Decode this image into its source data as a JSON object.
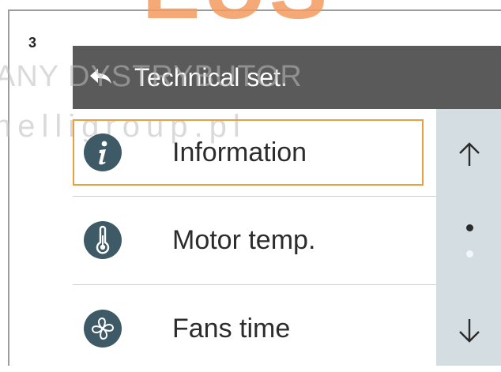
{
  "header": {
    "step_number": "3",
    "title": "Technical set."
  },
  "menu": {
    "items": [
      {
        "label": "Information",
        "icon": "info-icon",
        "selected": true
      },
      {
        "label": "Motor temp.",
        "icon": "thermometer-icon",
        "selected": false
      },
      {
        "label": "Fans time",
        "icon": "fan-icon",
        "selected": false
      }
    ]
  },
  "scrollbar": {
    "up_icon": "arrow-up-icon",
    "down_icon": "arrow-down-icon",
    "pages": 2,
    "current_page": 1
  },
  "watermark": {
    "brand": "EUS",
    "line1": "ANY DYSTRYBUTOR",
    "line2": "nelligroup.pl"
  },
  "colors": {
    "title_bar": "#5a5a5a",
    "icon_circle": "#3d5a66",
    "selection_border": "#e6a03e",
    "scroll_panel": "#d3dde2"
  }
}
